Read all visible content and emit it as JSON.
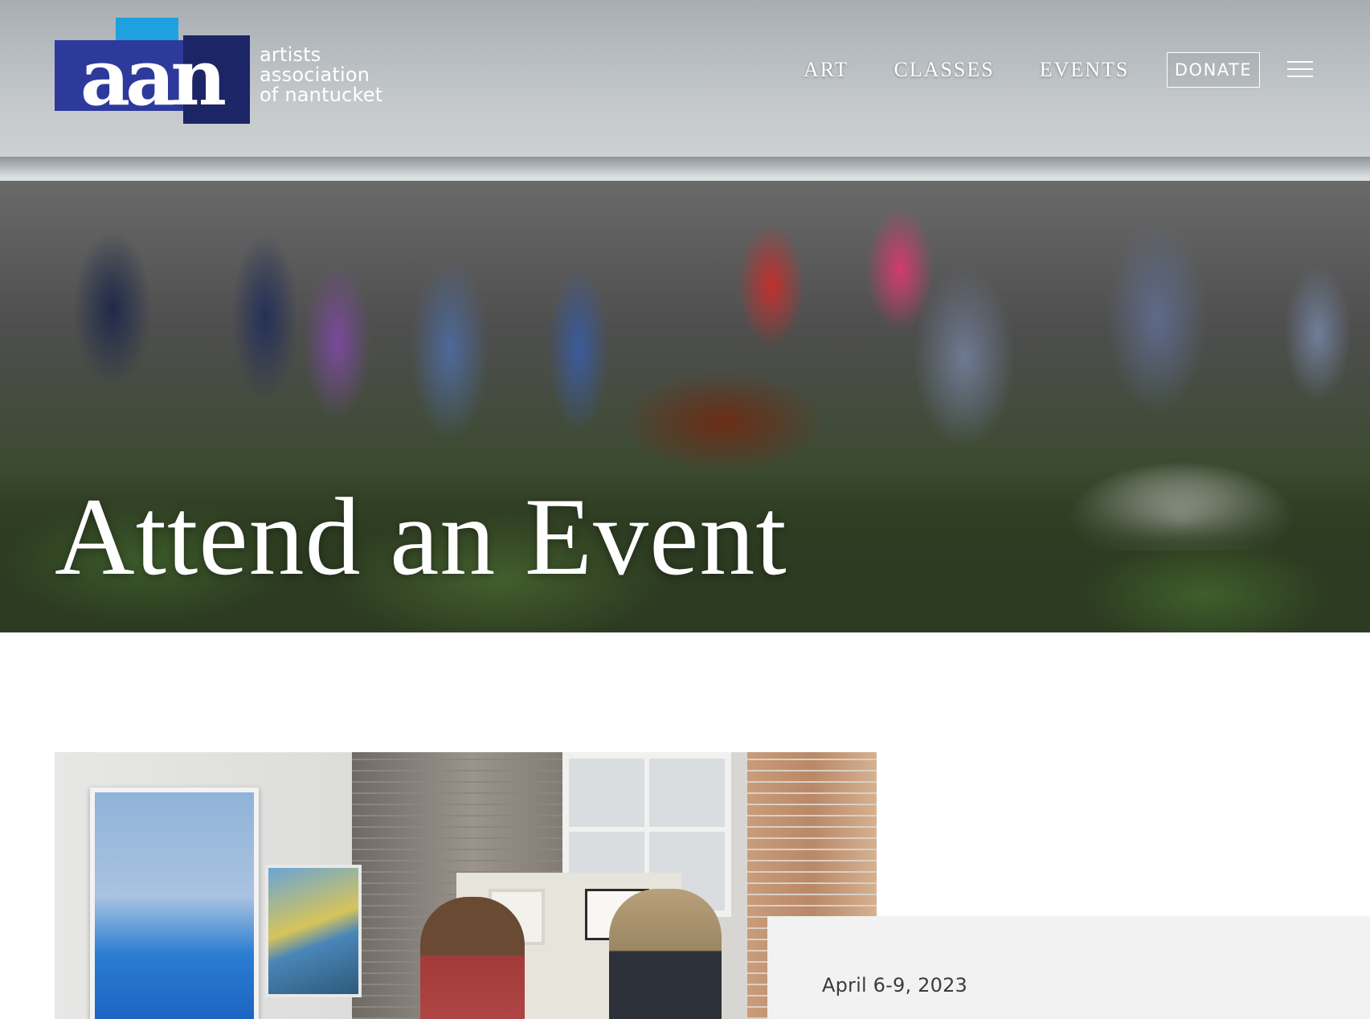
{
  "header": {
    "logo": {
      "mark": "aan",
      "text_lines": [
        "artists",
        "association",
        "of nantucket"
      ],
      "colors": {
        "light_blue": "#1fa0df",
        "royal_blue": "#2d3a9c",
        "navy": "#1c2566"
      }
    },
    "nav": [
      {
        "label": "ART"
      },
      {
        "label": "CLASSES"
      },
      {
        "label": "EVENTS"
      }
    ],
    "donate_label": "DONATE",
    "menu_icon": "hamburger-icon"
  },
  "hero": {
    "title": "Attend an Event"
  },
  "event": {
    "date": "April 6-9, 2023"
  }
}
